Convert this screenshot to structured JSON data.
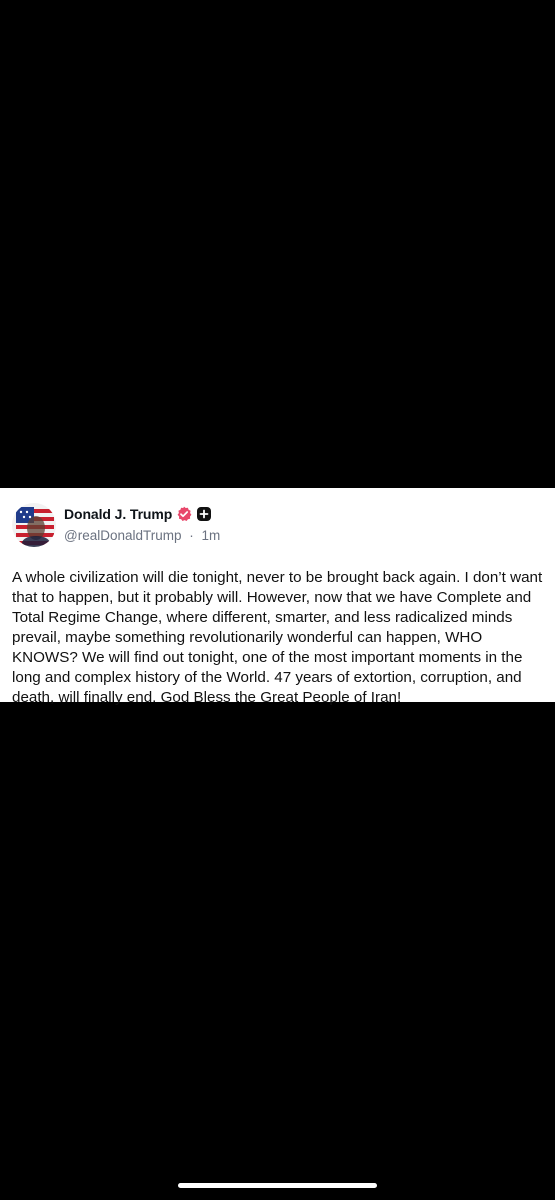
{
  "post": {
    "author": {
      "display_name": "Donald J. Trump",
      "handle": "@realDonaldTrump",
      "time_ago": "1m",
      "avatar_icon": "flag-portrait-avatar",
      "verified_icon": "verified-badge-icon",
      "verified_color": "#e8476b",
      "follow_icon": "plus-badge-icon"
    },
    "separator": "·",
    "text": "A whole civilization will die tonight, never to be brought back again. I don’t want that to happen, but it probably will. However, now that we have Complete and Total Regime Change, where different, smarter, and less radicalized minds prevail, maybe something revolutionarily wonderful can happen, WHO KNOWS? We will find out tonight, one of the most important moments in the long and complex history of the World. 47 years of extortion, corruption, and death, will finally end. God Bless the Great People of Iran!"
  }
}
